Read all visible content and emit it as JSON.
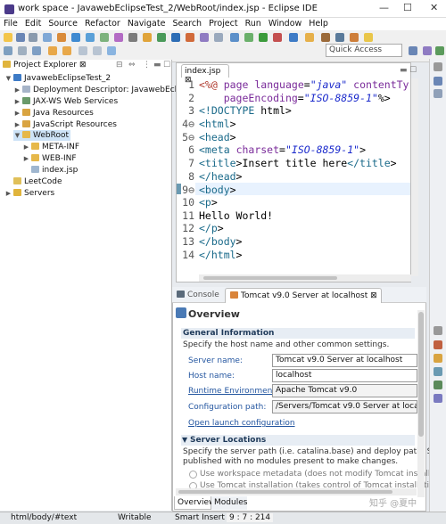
{
  "window": {
    "title": "work space - JavawebEclipseTest_2/WebRoot/index.jsp - Eclipse IDE",
    "minimize": "—",
    "maximize": "☐",
    "close": "✕"
  },
  "menu": [
    "File",
    "Edit",
    "Source",
    "Refactor",
    "Navigate",
    "Search",
    "Project",
    "Run",
    "Window",
    "Help"
  ],
  "quick_access": "Quick Access",
  "project_explorer": {
    "tab_label": "Project Explorer",
    "tab_close": "⊠",
    "items": [
      {
        "label": "JavawebEclipseTest_2",
        "level": 0,
        "open": true
      },
      {
        "label": "Deployment Descriptor: JavawebEclips",
        "level": 1,
        "open": false
      },
      {
        "label": "JAX-WS Web Services",
        "level": 1,
        "open": false
      },
      {
        "label": "Java Resources",
        "level": 1,
        "open": false
      },
      {
        "label": "JavaScript Resources",
        "level": 1,
        "open": false
      },
      {
        "label": "WebRoot",
        "level": 1,
        "open": true
      },
      {
        "label": "META-INF",
        "level": 2,
        "open": false
      },
      {
        "label": "WEB-INF",
        "level": 2,
        "open": false
      },
      {
        "label": "index.jsp",
        "level": 2,
        "open": false
      },
      {
        "label": "LeetCode",
        "level": 0,
        "open": false
      },
      {
        "label": "Servers",
        "level": 0,
        "open": false
      }
    ]
  },
  "editor": {
    "tab_label": "index.jsp",
    "tab_close": "⊠",
    "line_numbers": [
      "1",
      "2",
      "3",
      "4⊖",
      "5⊖",
      "6",
      "7",
      "8",
      "9⊖",
      "10",
      "11",
      "12",
      "13",
      "14"
    ],
    "lines": [
      "<%@ page language=\"java\" contentTy",
      "    pageEncoding=\"ISO-8859-1\"%>",
      "<!DOCTYPE html>",
      "<html>",
      "<head>",
      "<meta charset=\"ISO-8859-1\">",
      "<title>Insert title here</title>",
      "</head>",
      "<body>",
      "<p>",
      "Hello World!",
      "</p>",
      "</body>",
      "</html>"
    ]
  },
  "bottom_panel": {
    "tabs": [
      "Console",
      "Tomcat v9.0 Server at localhost"
    ],
    "tab_close": "⊠",
    "overview_title": "Overview",
    "general_info": {
      "title": "General Information",
      "desc": "Specify the host name and other common settings.",
      "fields": [
        {
          "label": "Server name:",
          "value": "Tomcat v9.0 Server at localhost",
          "link": false
        },
        {
          "label": "Host name:",
          "value": "localhost",
          "link": false
        },
        {
          "label": "Runtime Environment:",
          "value": "Apache Tomcat v9.0",
          "link": true
        },
        {
          "label": "Configuration path:",
          "value": "/Servers/Tomcat v9.0 Server at localhost-",
          "link": false
        }
      ],
      "open_launch": "Open launch configuration"
    },
    "server_locations": {
      "title": "Server Locations",
      "desc1": "Specify the server path (i.e. catalina.base) and deploy path. Server n",
      "desc2": "published with no modules present to make changes.",
      "options": [
        "Use workspace metadata (does not modify Tomcat installation)",
        "Use Tomcat installation (takes control of Tomcat installation)"
      ]
    },
    "bottom_tabs": [
      "Overview",
      "Modules"
    ]
  },
  "status_bar": {
    "path": "html/body/#text",
    "mode": "Writable",
    "insert": "Smart Insert",
    "position": "9 : 7 : 214"
  },
  "watermark": "知乎 @夏中"
}
